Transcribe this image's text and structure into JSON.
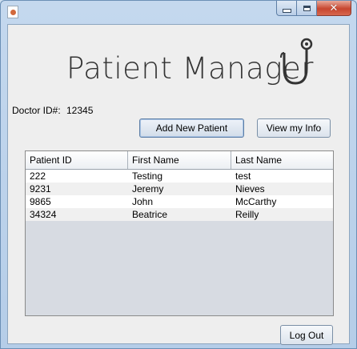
{
  "window": {
    "controls": {
      "minimize_icon": "minimize-icon",
      "maximize_icon": "maximize-icon",
      "close_icon": "close-icon",
      "close_glyph": "✕"
    }
  },
  "header": {
    "title": "Patient Manager",
    "logo_icon": "stethoscope-icon"
  },
  "doctor": {
    "label": "Doctor ID#:",
    "id": "12345"
  },
  "actions": {
    "add_patient": "Add New Patient",
    "view_info": "View my Info",
    "logout": "Log Out"
  },
  "table": {
    "columns": [
      "Patient ID",
      "First Name",
      "Last Name"
    ],
    "rows": [
      [
        "222",
        "Testing",
        "test"
      ],
      [
        "9231",
        "Jeremy",
        "Nieves"
      ],
      [
        "9865",
        "John",
        "McCarthy"
      ],
      [
        "34324",
        "Beatrice",
        "Reilly"
      ]
    ]
  },
  "colors": {
    "accent": "#5d7ea6",
    "close": "#c7462f",
    "table_empty": "#d7dbe2"
  }
}
